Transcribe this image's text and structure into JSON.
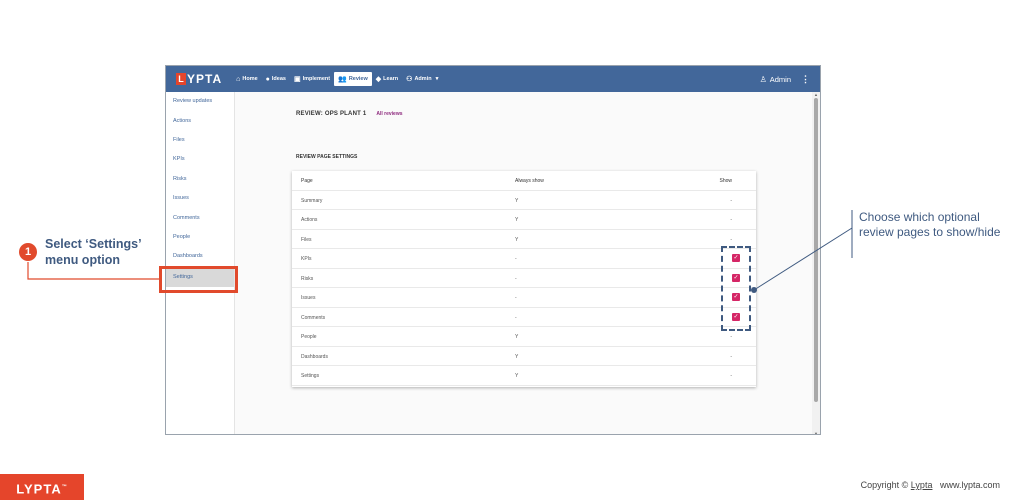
{
  "header": {
    "logo_mark": "L",
    "logo_text": "YPTA",
    "nav": [
      {
        "label": "Home",
        "icon": "home-icon",
        "glyph": "⌂"
      },
      {
        "label": "Ideas",
        "icon": "lightbulb-icon",
        "glyph": "●"
      },
      {
        "label": "Implement",
        "icon": "implement-icon",
        "glyph": "▣"
      },
      {
        "label": "Review",
        "icon": "review-icon",
        "glyph": "👥"
      },
      {
        "label": "Learn",
        "icon": "learn-icon",
        "glyph": "◆"
      },
      {
        "label": "Admin",
        "icon": "admin-icon",
        "glyph": "⚇"
      }
    ],
    "dropdown_glyph": "▾",
    "user_label": "Admin",
    "user_glyph": "♙",
    "kebab_glyph": "⋮"
  },
  "sidebar": {
    "items": [
      "Review updates",
      "Actions",
      "Files",
      "KPIs",
      "Risks",
      "Issues",
      "Comments",
      "People",
      "Dashboards",
      "Settings"
    ]
  },
  "content": {
    "title": "REVIEW: OPS PLANT 1",
    "all_reviews_link": "All reviews",
    "section_heading": "REVIEW PAGE SETTINGS"
  },
  "table": {
    "headers": {
      "page": "Page",
      "always_show": "Always show",
      "show": "Show"
    },
    "rows": [
      {
        "page": "Summary",
        "always": "Y",
        "show": "-"
      },
      {
        "page": "Actions",
        "always": "Y",
        "show": "-"
      },
      {
        "page": "Files",
        "always": "Y",
        "show": "-"
      },
      {
        "page": "KPIs",
        "always": "-",
        "show": "checked"
      },
      {
        "page": "Risks",
        "always": "-",
        "show": "checked"
      },
      {
        "page": "Issues",
        "always": "-",
        "show": "checked"
      },
      {
        "page": "Comments",
        "always": "-",
        "show": "checked"
      },
      {
        "page": "People",
        "always": "Y",
        "show": "-"
      },
      {
        "page": "Dashboards",
        "always": "Y",
        "show": "-"
      },
      {
        "page": "Settings",
        "always": "Y",
        "show": "-"
      }
    ],
    "check_glyph": "✓"
  },
  "annotations": {
    "step_number": "1",
    "step_text": "Select ‘Settings’ menu option",
    "callout_text": "Choose which optional review pages to show/hide"
  },
  "footer": {
    "logo_text": "LYPTA",
    "logo_tm": "™",
    "copyright_prefix": "Copyright ©",
    "copyright_brand": "Lypta",
    "website": "www.lypta.com"
  },
  "colors": {
    "topbar": "#42679a",
    "brand_orange": "#e5452b",
    "checkbox": "#d52666",
    "annotation_blue": "#3f5a80",
    "link_purple": "#8e2a7e"
  }
}
